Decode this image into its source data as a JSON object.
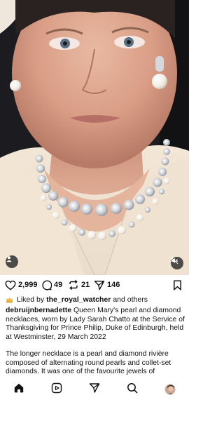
{
  "post": {
    "image_alt": "",
    "likes_count": "2,999",
    "comments_count": "49",
    "reposts_count": "21",
    "shares_count": "146",
    "liked_by_prefix": "Liked by",
    "liked_by_user": "the_royal_watcher",
    "liked_by_suffix": "and others",
    "username": "debruijnbernadette",
    "caption_p1": "Queen Mary's pearl and diamond necklaces, worn by Lady Sarah Chatto at the Service of Thanksgiving for Prince Philip, Duke of Edinburgh, held at Westminster, 29 March 2022",
    "caption_p2": "The longer necklace is a pearl and diamond rivière composed of alternating round pearls and collet-set diamonds. It was one of the favourite jewels of"
  },
  "icons": {
    "tag": "person-tag-icon",
    "mute": "speaker-muted-icon",
    "like": "heart-icon",
    "comment": "comment-bubble-icon",
    "repost": "repost-icon",
    "share": "paper-plane-icon",
    "save": "bookmark-icon",
    "liked_avatar": "crown-icon",
    "nav_home": "home-icon",
    "nav_reels": "reels-icon",
    "nav_send": "paper-plane-icon",
    "nav_search": "search-icon",
    "nav_profile": "profile-avatar"
  },
  "colors": {
    "text": "#111111",
    "background": "#ffffff",
    "overlay_button": "#282828"
  }
}
